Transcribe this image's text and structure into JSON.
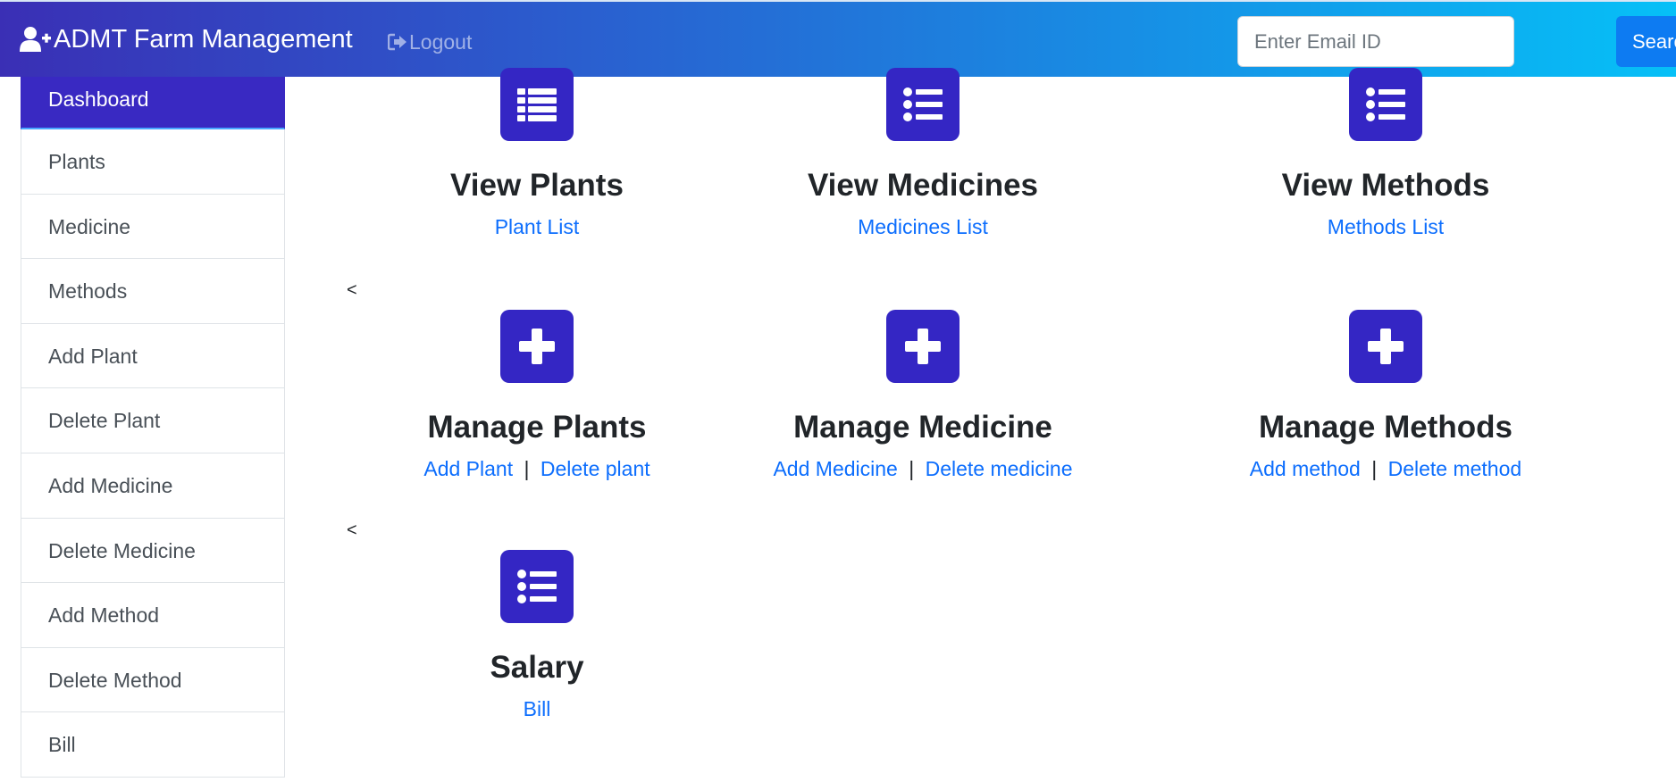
{
  "navbar": {
    "brand": "ADMT Farm Management",
    "logout": "Logout",
    "email_placeholder": "Enter Email ID",
    "search_label": "Search"
  },
  "sidebar": {
    "items": [
      {
        "label": "Dashboard"
      },
      {
        "label": "Plants"
      },
      {
        "label": "Medicine"
      },
      {
        "label": "Methods"
      },
      {
        "label": "Add Plant"
      },
      {
        "label": "Delete Plant"
      },
      {
        "label": "Add Medicine"
      },
      {
        "label": "Delete Medicine"
      },
      {
        "label": "Add Method"
      },
      {
        "label": "Delete Method"
      },
      {
        "label": "Bill"
      }
    ]
  },
  "main": {
    "stray_char": "<",
    "cards": [
      {
        "title": "View Plants",
        "icon": "list-icon",
        "links": [
          "Plant List"
        ]
      },
      {
        "title": "View Medicines",
        "icon": "list-icon",
        "links": [
          "Medicines List"
        ]
      },
      {
        "title": "View Methods",
        "icon": "list-icon",
        "links": [
          "Methods List"
        ]
      },
      {
        "title": "Manage Plants",
        "icon": "plus-icon",
        "links": [
          "Add Plant",
          "Delete plant"
        ]
      },
      {
        "title": "Manage Medicine",
        "icon": "plus-icon",
        "links": [
          "Add Medicine",
          "Delete medicine"
        ]
      },
      {
        "title": "Manage Methods",
        "icon": "plus-icon",
        "links": [
          "Add method",
          "Delete method"
        ]
      },
      {
        "title": "Salary",
        "icon": "list-icon",
        "links": [
          "Bill"
        ]
      }
    ],
    "link_separator": "|"
  },
  "colors": {
    "accent": "#3426c4",
    "link": "#0d6efd",
    "search_button": "#0d7bf2"
  }
}
